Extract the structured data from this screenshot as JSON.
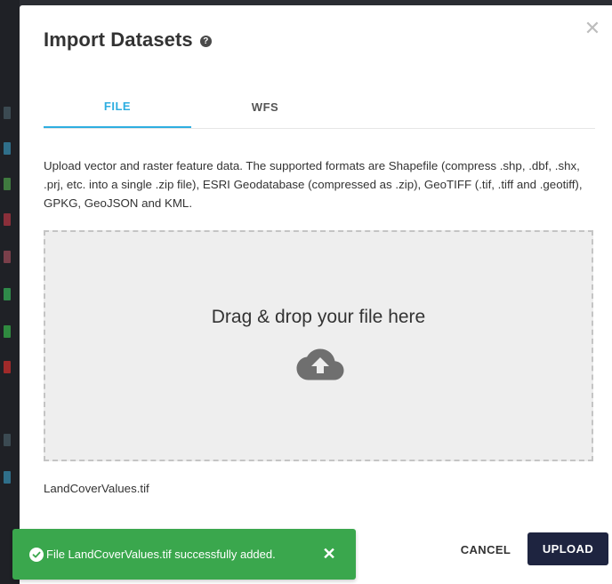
{
  "dialog": {
    "title": "Import Datasets",
    "help_icon": "question-circle-icon",
    "close_icon": "close-icon"
  },
  "tabs": [
    {
      "label": "FILE",
      "active": true
    },
    {
      "label": "WFS",
      "active": false
    }
  ],
  "description": "Upload vector and raster feature data. The supported formats are Shapefile (compress .shp, .dbf, .shx, .prj, etc. into a single .zip file), ESRI Geodatabase (compressed as .zip), GeoTIFF (.tif, .tiff and .geotiff), GPKG, GeoJSON and KML.",
  "dropzone": {
    "text": "Drag & drop your file here",
    "icon": "cloud-upload-icon"
  },
  "selected_file": "LandCoverValues.tif",
  "actions": {
    "cancel_label": "CANCEL",
    "upload_label": "UPLOAD"
  },
  "snackbar": {
    "message": "File LandCoverValues.tif successfully added.",
    "icon": "check-circle-icon",
    "close_icon": "close-icon"
  },
  "colors": {
    "accent": "#2eaee0",
    "primary_button": "#1e2440",
    "success": "#3aa74d",
    "dropzone_bg": "#eeeeee"
  }
}
